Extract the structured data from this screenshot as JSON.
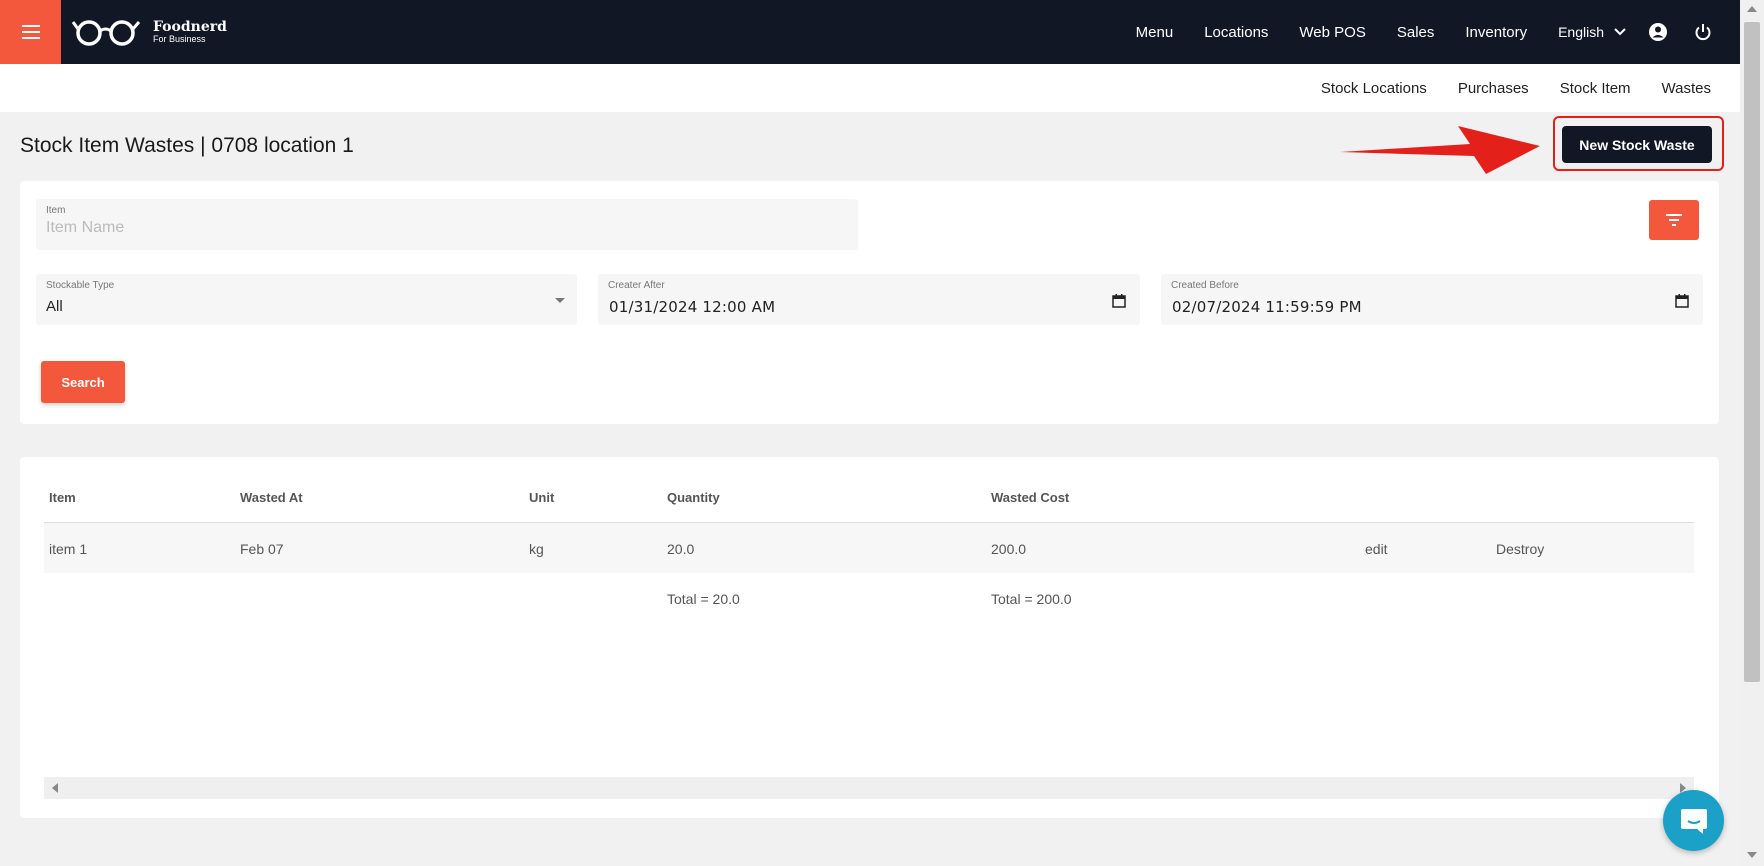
{
  "brand": {
    "name": "Foodnerd",
    "tagline": "For Business"
  },
  "nav": {
    "items": [
      "Menu",
      "Locations",
      "Web POS",
      "Sales",
      "Inventory"
    ],
    "language": "English"
  },
  "subnav": {
    "items": [
      "Stock Locations",
      "Purchases",
      "Stock Item",
      "Wastes"
    ]
  },
  "page": {
    "title": "Stock Item Wastes | 0708 location 1",
    "new_button": "New Stock Waste"
  },
  "filters": {
    "item": {
      "label": "Item",
      "placeholder": "Item Name",
      "value": ""
    },
    "stockable_type": {
      "label": "Stockable Type",
      "value": "All"
    },
    "created_after": {
      "label": "Creater After",
      "value": "01/31/2024 12:00 AM"
    },
    "created_before": {
      "label": "Created Before",
      "value": "02/07/2024 11:59:59 PM"
    },
    "search_label": "Search"
  },
  "table": {
    "headers": [
      "Item",
      "Wasted At",
      "Unit",
      "Quantity",
      "Wasted Cost"
    ],
    "rows": [
      {
        "item": "item 1",
        "wasted_at": "Feb 07",
        "unit": "kg",
        "quantity": "20.0",
        "wasted_cost": "200.0",
        "edit": "edit",
        "destroy": "Destroy"
      }
    ],
    "totals": {
      "quantity": "Total = 20.0",
      "wasted_cost": "Total = 200.0"
    }
  },
  "colors": {
    "primary": "#f3573c",
    "dark": "#121726",
    "annotation": "#e4201b",
    "chat": "#1ba0c7"
  }
}
